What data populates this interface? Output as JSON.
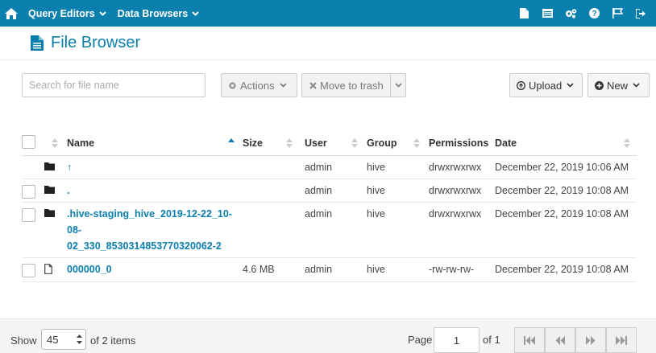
{
  "navbar": {
    "home_icon": "home-icon",
    "menus": [
      {
        "label": "Query Editors"
      },
      {
        "label": "Data Browsers"
      }
    ],
    "right_icons": [
      "document-icon",
      "table-icon",
      "gears-icon",
      "help-icon",
      "flag-icon",
      "logout-icon"
    ],
    "background": "#0B7FAD"
  },
  "page": {
    "title": "File Browser",
    "title_icon": "file-icon"
  },
  "toolbar": {
    "search_placeholder": "Search for file name",
    "actions_label": "Actions",
    "move_to_trash_label": "Move to trash",
    "upload_label": "Upload",
    "new_label": "New"
  },
  "table": {
    "headers": {
      "name": "Name",
      "size": "Size",
      "user": "User",
      "group": "Group",
      "permissions": "Permissions",
      "date": "Date"
    },
    "sort_column": "Name",
    "sort_direction": "ascending",
    "rows": [
      {
        "type": "folder",
        "name": "↑",
        "size": "",
        "user": "admin",
        "group": "hive",
        "permissions": "drwxrwxrwx",
        "date": "December 22, 2019 10:06 AM",
        "checkbox": false
      },
      {
        "type": "folder",
        "name": ".",
        "size": "",
        "user": "admin",
        "group": "hive",
        "permissions": "drwxrwxrwx",
        "date": "December 22, 2019 10:08 AM",
        "checkbox": true
      },
      {
        "type": "folder",
        "name_lines": [
          ".hive-staging_hive_2019-12-22_10-",
          "08-",
          "02_330_8530314853770320062-2"
        ],
        "size": "",
        "user": "admin",
        "group": "hive",
        "permissions": "drwxrwxrwx",
        "date": "December 22, 2019 10:08 AM",
        "checkbox": true
      },
      {
        "type": "file",
        "name": "000000_0",
        "size": "4.6 MB",
        "user": "admin",
        "group": "hive",
        "permissions": "-rw-rw-rw-",
        "date": "December 22, 2019 10:08 AM",
        "checkbox": true
      }
    ]
  },
  "footer": {
    "show_label": "Show",
    "page_size": "45",
    "items_text": "of 2 items",
    "page_label": "Page",
    "page_value": "1",
    "of_pages": "of 1",
    "pager_icons": [
      "first-page-icon",
      "previous-page-icon",
      "next-page-icon",
      "last-page-icon"
    ]
  }
}
